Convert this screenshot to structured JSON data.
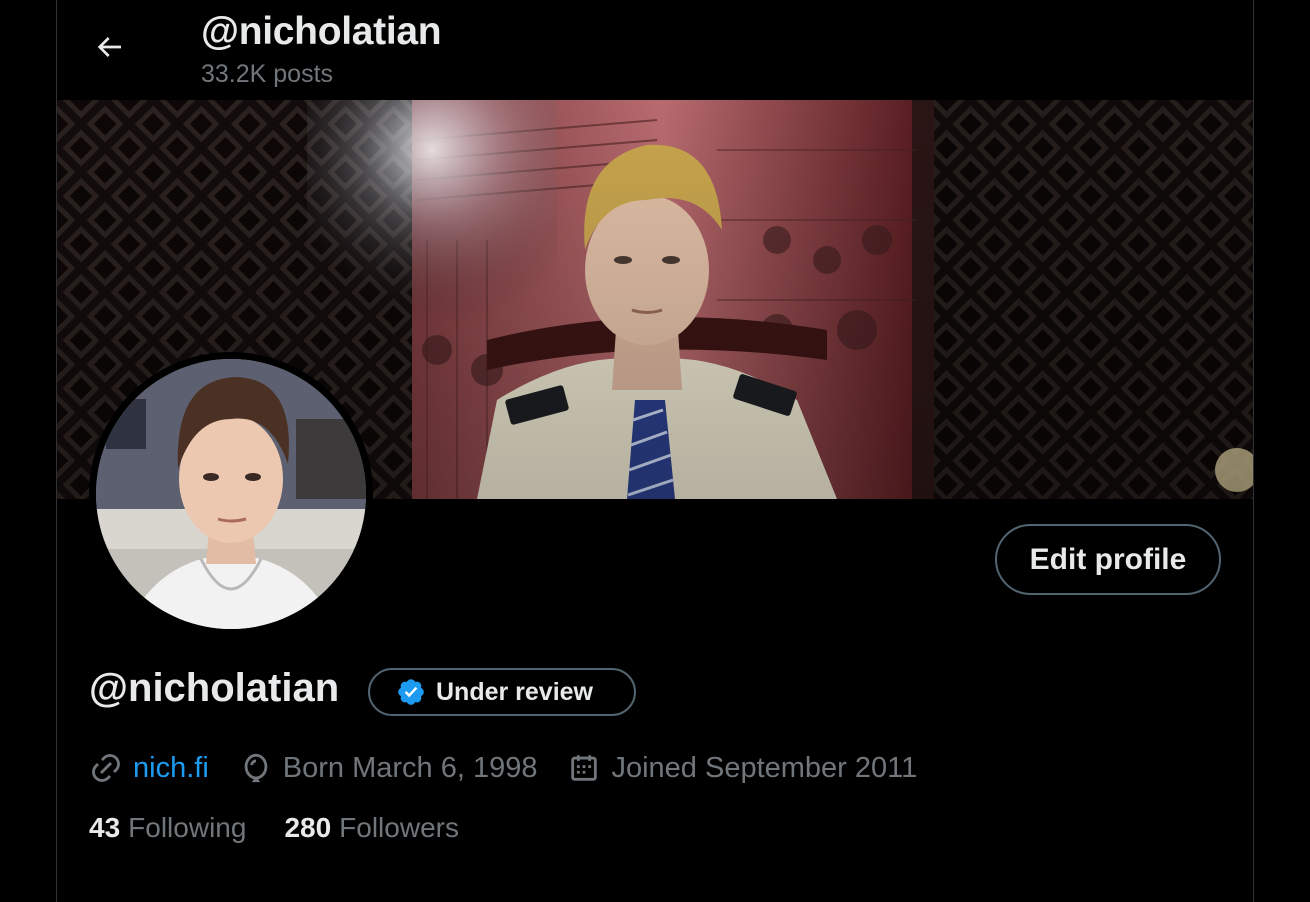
{
  "header": {
    "title": "@nicholatian",
    "posts_count": "33.2K posts",
    "back_icon": "arrow-left-icon"
  },
  "profile": {
    "display_name": "@nicholatian",
    "verification_badge": {
      "icon": "verified-check-icon",
      "label": "Under review",
      "color": "#1d9bf0"
    },
    "edit_button_label": "Edit profile",
    "meta": {
      "website": "nich.fi",
      "birthday": "Born March 6, 1998",
      "joined": "Joined September 2011"
    },
    "stats": {
      "following_count": "43",
      "following_label": "Following",
      "followers_count": "280",
      "followers_label": "Followers"
    }
  },
  "colors": {
    "background": "#000000",
    "text_primary": "#e7e9ea",
    "text_secondary": "#71767b",
    "accent": "#1d9bf0",
    "border": "#2f3336"
  }
}
